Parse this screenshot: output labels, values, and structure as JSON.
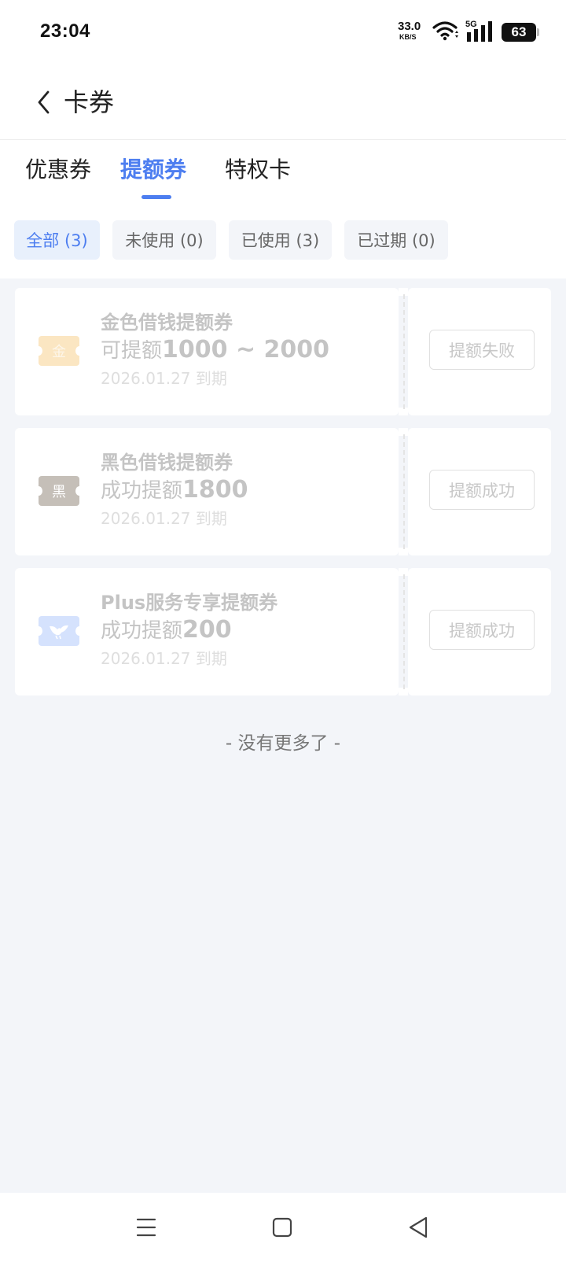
{
  "status_bar": {
    "time": "23:04",
    "net_speed_value": "33.0",
    "net_speed_unit": "KB/S",
    "network_label": "5G",
    "battery": "63",
    "icons": [
      "wifi-icon",
      "signal-icon",
      "battery-icon"
    ]
  },
  "header": {
    "title": "卡券",
    "back_icon": "chevron-left-icon"
  },
  "tabs": [
    {
      "label": "优惠券",
      "active": false
    },
    {
      "label": "提额券",
      "active": true
    },
    {
      "label": "特权卡",
      "active": false
    }
  ],
  "filters": [
    {
      "label": "全部 (3)",
      "active": true
    },
    {
      "label": "未使用 (0)",
      "active": false
    },
    {
      "label": "已使用 (3)",
      "active": false
    },
    {
      "label": "已过期 (0)",
      "active": false
    }
  ],
  "coupons": [
    {
      "badge": "金",
      "badge_color": "#fbe6c2",
      "title": "金色借钱提额券",
      "amount_prefix": "可提额",
      "amount": "1000 ~ 2000",
      "expiry": "2026.01.27 到期",
      "status": "提额失败"
    },
    {
      "badge": "黑",
      "badge_color": "#c5bfb8",
      "title": "黑色借钱提额券",
      "amount_prefix": "成功提额",
      "amount": "1800",
      "expiry": "2026.01.27 到期",
      "status": "提额成功"
    },
    {
      "badge": "",
      "badge_icon": "bird-icon",
      "badge_color": "#d5e2fd",
      "title": "Plus服务专享提额券",
      "amount_prefix": "成功提额",
      "amount": "200",
      "expiry": "2026.01.27 到期",
      "status": "提额成功"
    }
  ],
  "footer_text": "- 没有更多了 -",
  "system_nav": {
    "icons": [
      "menu-icon",
      "home-icon",
      "back-triangle-icon"
    ]
  },
  "colors": {
    "accent": "#4d7ef0",
    "page_bg": "#f3f5f9",
    "chip_active_bg": "#e8f0fc"
  }
}
